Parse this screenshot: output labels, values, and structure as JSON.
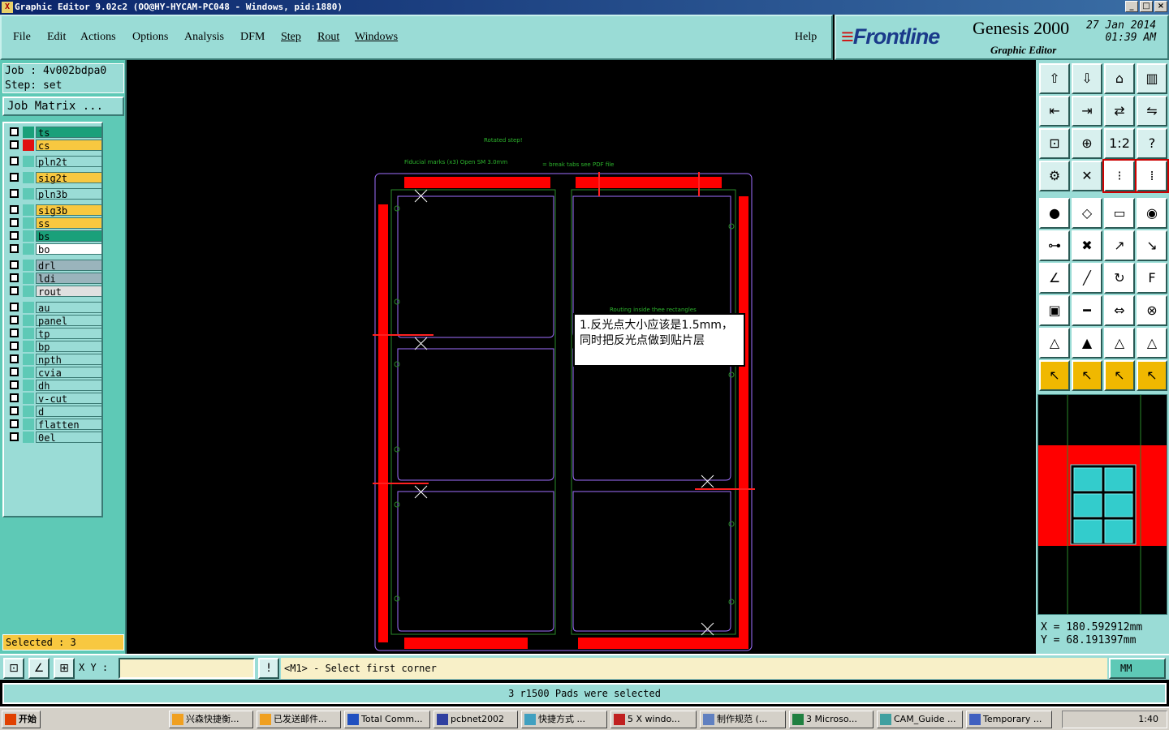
{
  "window": {
    "title": "Graphic Editor 9.02c2  (OO@HY-HYCAM-PC048 - Windows, pid:1880)",
    "controls": [
      "_",
      "□",
      "×"
    ]
  },
  "menu": {
    "items": [
      "File",
      "Edit",
      "Actions",
      "Options",
      "Analysis",
      "DFM",
      "Step",
      "Rout",
      "Windows"
    ],
    "help": "Help"
  },
  "brand": {
    "logo": "Frontline",
    "product": "Genesis 2000",
    "subtitle": "Graphic Editor",
    "date": "27 Jan 2014",
    "time": "01:39 AM"
  },
  "job": {
    "job_label": "Job : 4v002bdpa0",
    "step_label": "Step: set",
    "matrix_button": "Job Matrix ..."
  },
  "layers": [
    {
      "name": "ts",
      "color": "#1aa07a",
      "swatch": "#1aa07a"
    },
    {
      "name": "cs",
      "color": "#f8c840",
      "swatch": "#e01010"
    },
    {
      "name": "pln2t",
      "color": "#9adcd6",
      "swatch": "#5ec9b6"
    },
    {
      "name": "sig2t",
      "color": "#f8c840",
      "swatch": "#5ec9b6"
    },
    {
      "name": "pln3b",
      "color": "#9adcd6",
      "swatch": "#5ec9b6"
    },
    {
      "name": "sig3b",
      "color": "#f8c840",
      "swatch": "#5ec9b6"
    },
    {
      "name": "ss",
      "color": "#f8c840",
      "swatch": "#5ec9b6"
    },
    {
      "name": "bs",
      "color": "#1aa07a",
      "swatch": "#5ec9b6"
    },
    {
      "name": "bo",
      "color": "#ffffff",
      "swatch": "#5ec9b6"
    },
    {
      "name": "drl",
      "color": "#9ab4bc",
      "swatch": "#5ec9b6"
    },
    {
      "name": "ldi",
      "color": "#9ab4bc",
      "swatch": "#5ec9b6"
    },
    {
      "name": "rout",
      "color": "#e0e0e0",
      "swatch": "#5ec9b6"
    },
    {
      "name": "au",
      "color": "#9adcd6",
      "swatch": "#5ec9b6"
    },
    {
      "name": "panel",
      "color": "#9adcd6",
      "swatch": "#5ec9b6"
    },
    {
      "name": "tp",
      "color": "#9adcd6",
      "swatch": "#5ec9b6"
    },
    {
      "name": "bp",
      "color": "#9adcd6",
      "swatch": "#5ec9b6"
    },
    {
      "name": "npth",
      "color": "#9adcd6",
      "swatch": "#5ec9b6"
    },
    {
      "name": "cvia",
      "color": "#9adcd6",
      "swatch": "#5ec9b6"
    },
    {
      "name": "dh",
      "color": "#9adcd6",
      "swatch": "#5ec9b6"
    },
    {
      "name": "v-cut",
      "color": "#9adcd6",
      "swatch": "#5ec9b6"
    },
    {
      "name": "d",
      "color": "#9adcd6",
      "swatch": "#5ec9b6"
    },
    {
      "name": "flatten",
      "color": "#9adcd6",
      "swatch": "#5ec9b6"
    },
    {
      "name": "0el",
      "color": "#9adcd6",
      "swatch": "#5ec9b6"
    }
  ],
  "selected_label": "Selected : 3",
  "canvas": {
    "label_rotated": "Rotated step!",
    "label_fiducial": "Fiducial marks (x3) Open SM 3.0mm",
    "label_break": "= break tabs see PDF file",
    "label_routing": "Routing inside thee rectangles",
    "annotation": "1.反光点大小应该是1.5mm，同时把反光点做到贴片层"
  },
  "toolbar_icons": [
    "open-step-icon",
    "save-icon",
    "home-icon",
    "window-icon",
    "import-icon",
    "export-icon",
    "flip-icon",
    "route-icon",
    "zoom-fit-icon",
    "zoom-center-icon",
    "scale-1-2-icon",
    "help-icon",
    "measure-icon",
    "cut-icon",
    "netlist-icon",
    "netlist-alt-icon",
    "pad-icon",
    "shape-icon",
    "ruler-icon",
    "dot-icon",
    "node-icon",
    "snap-icon",
    "connect-icon",
    "connect-alt-icon",
    "angle-icon",
    "line-icon",
    "arc-icon",
    "text-f-icon",
    "select-pad-icon",
    "minus-icon",
    "dimension-icon",
    "group-icon",
    "triangle-icon",
    "triangle-a-icon",
    "triangle-b-icon",
    "triangle-c-icon",
    "pointer-icon",
    "pointer-box-icon",
    "pointer-highlight-icon",
    "pointer-path-icon"
  ],
  "coords": {
    "x": "X = 180.592912mm",
    "y": "Y = 68.191397mm"
  },
  "cmdbar": {
    "xy_label": "X Y :",
    "prompt": "<M1> - Select first corner",
    "unit": "MM"
  },
  "status": "3 r1500 Pads were selected",
  "taskbar": {
    "start": "开始",
    "buttons": [
      "兴森快捷衡...",
      "已发送邮件...",
      "Total Comm...",
      "pcbnet2002",
      "快捷方式 ...",
      "5 X windo...",
      "制作规范 (...",
      "3 Microso...",
      "CAM_Guide ...",
      "Temporary ..."
    ],
    "clock": "1:40"
  }
}
